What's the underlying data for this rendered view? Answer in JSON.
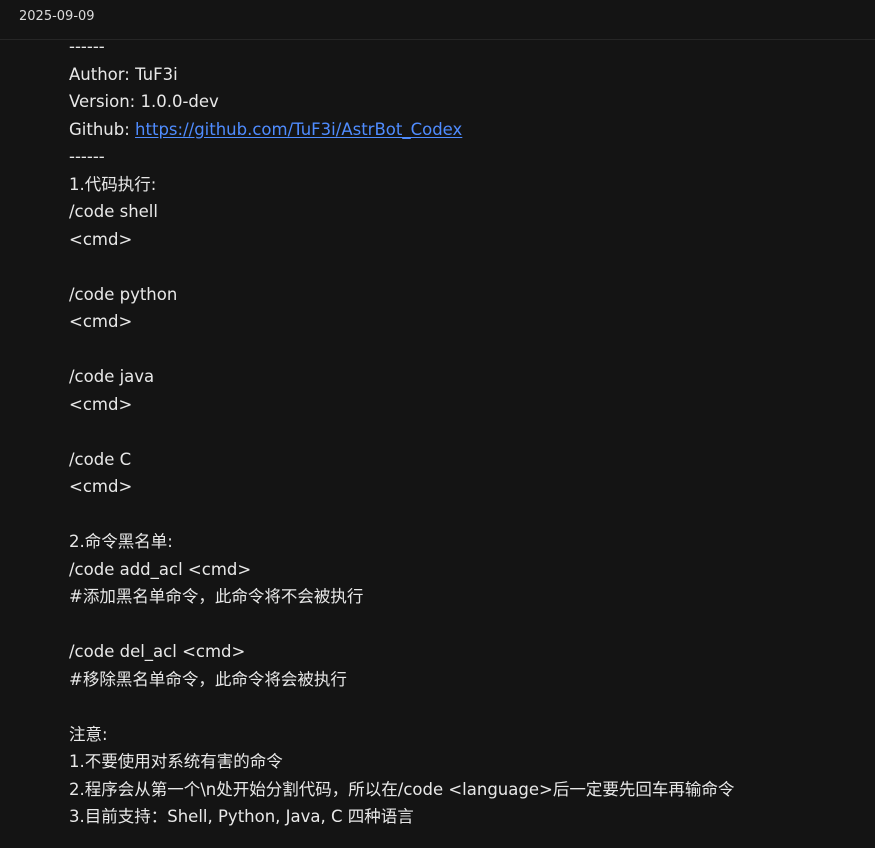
{
  "header": {
    "date": "2025-09-09"
  },
  "content": {
    "sep1": "------",
    "author_line": "Author: TuF3i",
    "version_line": "Version: 1.0.0-dev",
    "github_label": "Github: ",
    "github_url": "https://github.com/TuF3i/AstrBot_Codex",
    "sep2": "------",
    "section1_title": "1.代码执行:",
    "code_shell": "/code shell",
    "cmd1": "<cmd>",
    "code_python": "/code python",
    "cmd2": "<cmd>",
    "code_java": "/code java",
    "cmd3": "<cmd>",
    "code_c": "/code C",
    "cmd4": "<cmd>",
    "section2_title": "2.命令黑名单:",
    "add_acl": "/code add_acl <cmd>",
    "add_acl_desc": "#添加黑名单命令，此命令将不会被执行",
    "del_acl": "/code del_acl <cmd>",
    "del_acl_desc": "#移除黑名单命令，此命令将会被执行",
    "notes_title": "注意:",
    "note1": "1.不要使用对系统有害的命令",
    "note2": "2.程序会从第一个\\n处开始分割代码，所以在/code <language>后一定要先回车再输命令",
    "note3": "3.目前支持：Shell, Python, Java, C 四种语言"
  },
  "colors": {
    "background": "#141414",
    "text": "#e8e8e8",
    "link": "#4f8cff"
  }
}
